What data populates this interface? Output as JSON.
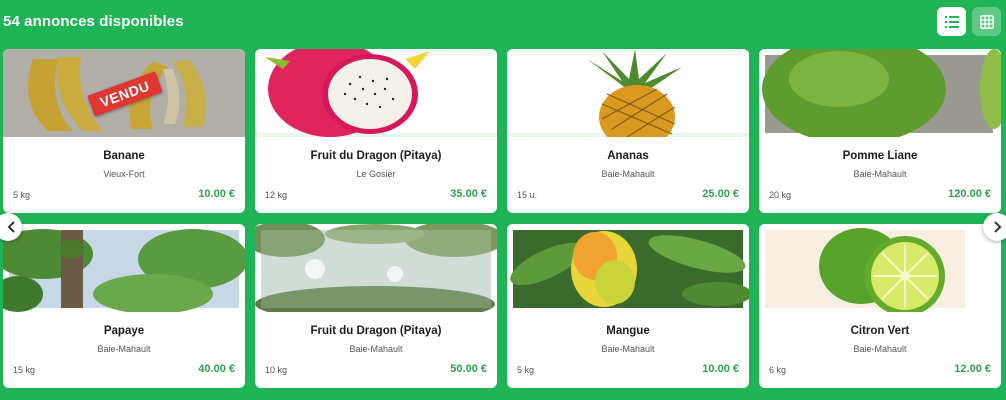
{
  "header": {
    "count_label": "54 annonces disponibles"
  },
  "view_toggle": {
    "list_icon": "list-icon",
    "grid_icon": "grid-icon"
  },
  "carousel": {
    "prev_icon": "chevron-left-icon",
    "next_icon": "chevron-right-icon"
  },
  "listings": [
    {
      "name": "Banane",
      "location": "Vieux-Fort",
      "quantity": "5 kg",
      "price": "10.00 €",
      "badge": "VENDU",
      "image": "banana"
    },
    {
      "name": "Fruit du Dragon (Pitaya)",
      "location": "Le Gosier",
      "quantity": "12 kg",
      "price": "35.00 €",
      "image": "dragon-fruit"
    },
    {
      "name": "Ananas",
      "location": "Baie-Mahault",
      "quantity": "15 u.",
      "price": "25.00 €",
      "image": "pineapple"
    },
    {
      "name": "Pomme Liane",
      "location": "Baie-Mahault",
      "quantity": "20 kg",
      "price": "120.00 €",
      "image": "passion-fruit"
    },
    {
      "name": "Papaye",
      "location": "Baie-Mahault",
      "quantity": "15 kg",
      "price": "40.00 €",
      "image": "papaya-tree"
    },
    {
      "name": "Fruit du Dragon (Pitaya)",
      "location": "Baie-Mahault",
      "quantity": "10 kg",
      "price": "50.00 €",
      "image": "tree-canopy"
    },
    {
      "name": "Mangue",
      "location": "Baie-Mahault",
      "quantity": "5 kg",
      "price": "10.00 €",
      "image": "mango"
    },
    {
      "name": "Citron Vert",
      "location": "Baie-Mahault",
      "quantity": "6 kg",
      "price": "12.00 €",
      "image": "lime"
    }
  ]
}
